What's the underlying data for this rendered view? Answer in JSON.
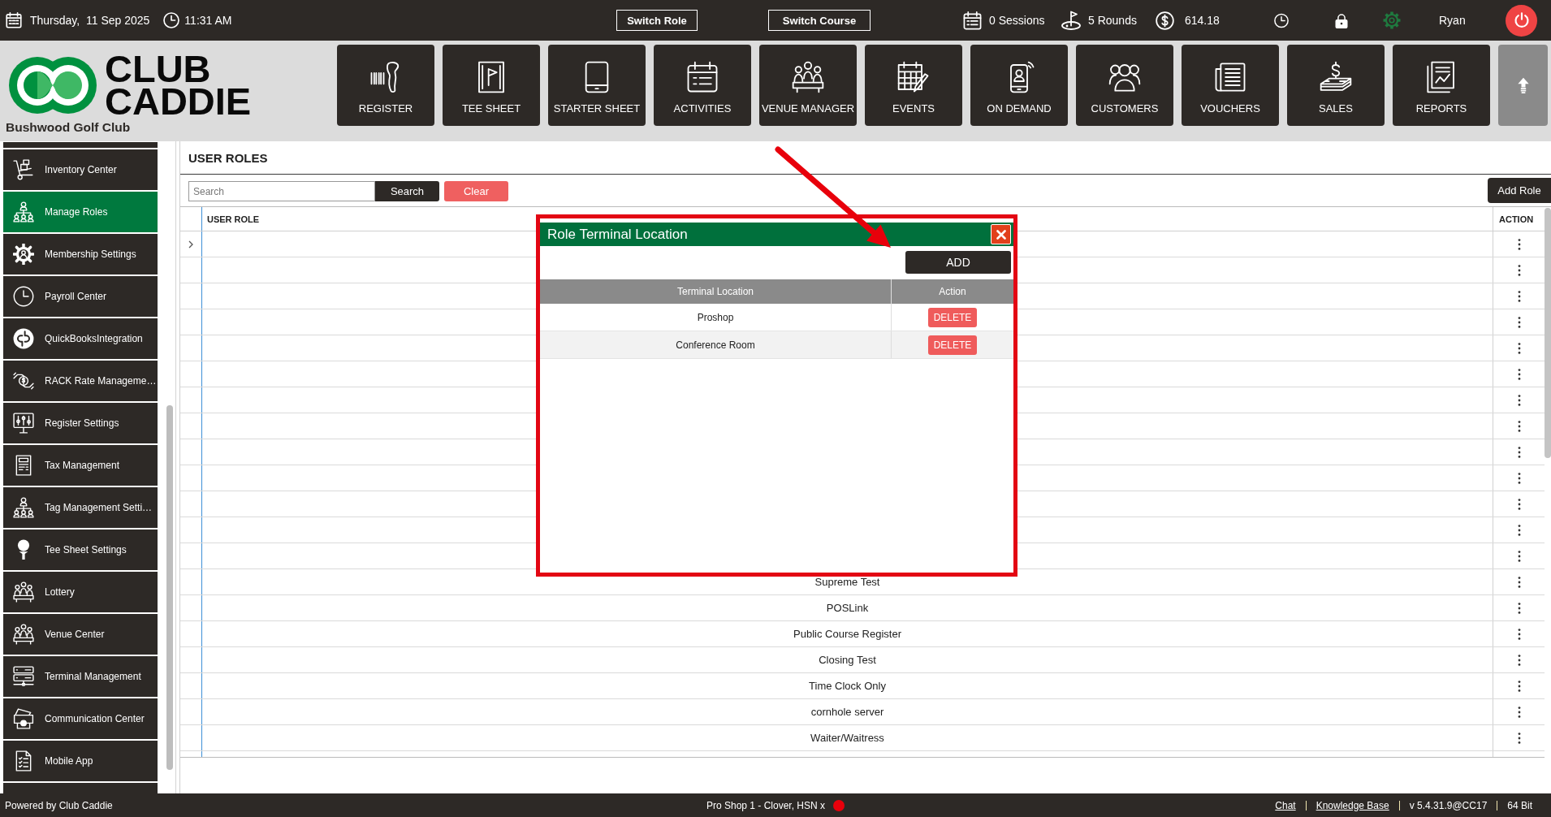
{
  "top_bar": {
    "date": "Thursday,  11 Sep 2025",
    "time": "11:31 AM",
    "switch_buttons": [
      "Switch Role",
      "Switch Course"
    ],
    "sessions": "0 Sessions",
    "rounds": "5 Rounds",
    "balance": "614.18",
    "user": "Ryan"
  },
  "header": {
    "logo_lines": [
      "CLUB",
      "CADDIE"
    ],
    "club_name": "Bushwood Golf Club",
    "nav_tiles": [
      "REGISTER",
      "TEE SHEET",
      "STARTER SHEET",
      "ACTIVITIES",
      "VENUE MANAGER",
      "EVENTS",
      "ON DEMAND",
      "CUSTOMERS",
      "VOUCHERS",
      "SALES",
      "REPORTS"
    ]
  },
  "sidebar": {
    "items": [
      {
        "label": "Inventory Center",
        "selected": false
      },
      {
        "label": "Manage Roles",
        "selected": true
      },
      {
        "label": "Membership Settings",
        "selected": false
      },
      {
        "label": "Payroll Center",
        "selected": false
      },
      {
        "label": "QuickBooksIntegration",
        "selected": false
      },
      {
        "label": "RACK Rate Manageme…",
        "selected": false
      },
      {
        "label": "Register Settings",
        "selected": false
      },
      {
        "label": "Tax Management",
        "selected": false
      },
      {
        "label": "Tag Management Setti…",
        "selected": false
      },
      {
        "label": "Tee Sheet Settings",
        "selected": false
      },
      {
        "label": "Lottery",
        "selected": false
      },
      {
        "label": "Venue Center",
        "selected": false
      },
      {
        "label": "Terminal Management",
        "selected": false
      },
      {
        "label": "Communication Center",
        "selected": false
      },
      {
        "label": "Mobile App",
        "selected": false
      }
    ]
  },
  "user_roles": {
    "title": "USER ROLES",
    "search": {
      "placeholder": "Search"
    },
    "search_button": "Search",
    "clear_button": "Clear",
    "add_button": "Add Role",
    "table": {
      "columns": [
        "USER ROLE",
        "ACTION"
      ],
      "rows": [
        {
          "expandable": true
        },
        {
          "expandable": false
        },
        {
          "expandable": false
        },
        {
          "expandable": false
        },
        {
          "expandable": false
        },
        {
          "expandable": false
        },
        {
          "expandable": false
        },
        {
          "expandable": false
        },
        {
          "expandable": false
        },
        {
          "expandable": false
        },
        {
          "expandable": false
        },
        {
          "expandable": false
        },
        {
          "expandable": false
        },
        {
          "expandable": false,
          "user_role": "Supreme Test"
        },
        {
          "expandable": false,
          "user_role": "POSLink"
        },
        {
          "expandable": false,
          "user_role": "Public Course Register"
        },
        {
          "expandable": false,
          "user_role": "Closing Test"
        },
        {
          "expandable": false,
          "user_role": "Time Clock Only"
        },
        {
          "expandable": false,
          "user_role": "cornhole server"
        },
        {
          "expandable": false,
          "user_role": "Waiter/Waitress"
        }
      ]
    }
  },
  "dialog": {
    "title": "Role Terminal Location",
    "add_button": "ADD",
    "table": {
      "columns": [
        "Terminal Location",
        "Action"
      ],
      "rows": [
        {
          "terminal_location": "Proshop",
          "action": "DELETE"
        },
        {
          "terminal_location": "Conference Room",
          "action": "DELETE"
        }
      ]
    }
  },
  "status_bar": {
    "powered_by": "Powered by Club Caddie",
    "terminal": "Pro Shop 1 - Clover, HSN x",
    "links": [
      "Chat",
      "Knowledge Base"
    ],
    "version": "v 5.4.31.9@CC17",
    "build": "64 Bit"
  }
}
